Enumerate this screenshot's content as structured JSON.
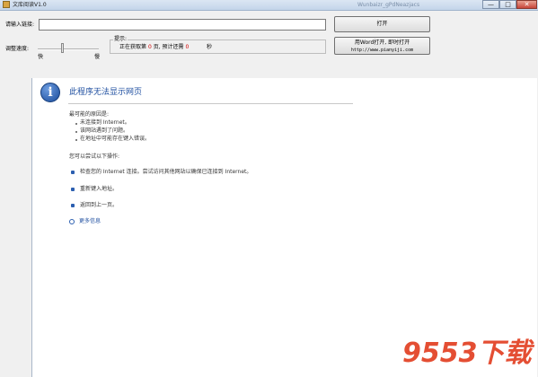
{
  "window": {
    "title": "文库阅读V1.0",
    "background_title": "Wunbaizr_gPdNeazjacs",
    "minimize": "—",
    "maximize": "□",
    "close": "✕"
  },
  "controls": {
    "url_label": "请输入链接:",
    "url_value": "",
    "open_button": "打开",
    "speed_label": "调整速度:",
    "speed_fast": "快",
    "speed_slow": "慢",
    "speed_level": 0.4,
    "hint_title": "提示:",
    "hint_prefix": "正在获取第",
    "hint_page": "0",
    "hint_middle": "页, 预计还需",
    "hint_seconds": "0",
    "hint_suffix": "秒",
    "word_button_line1": "用Word打开, 即时打开",
    "word_button_line2": "http://www.pianyiji.com"
  },
  "browser": {
    "error_title": "此程序无法显示网页",
    "causes_heading": "最可能的原因是:",
    "causes": [
      "未连接到 Internet。",
      "该网站遇到了问题。",
      "在地址中可能存在键入错误。"
    ],
    "try_heading": "您可以尝试以下操作:",
    "actions": [
      "检查您的 Internet 连接。尝试访问其他网站以确保已连接到 Internet。",
      "重新键入地址。",
      "返回到上一页。"
    ],
    "more_info": "更多信息"
  },
  "watermark": "9553下载"
}
